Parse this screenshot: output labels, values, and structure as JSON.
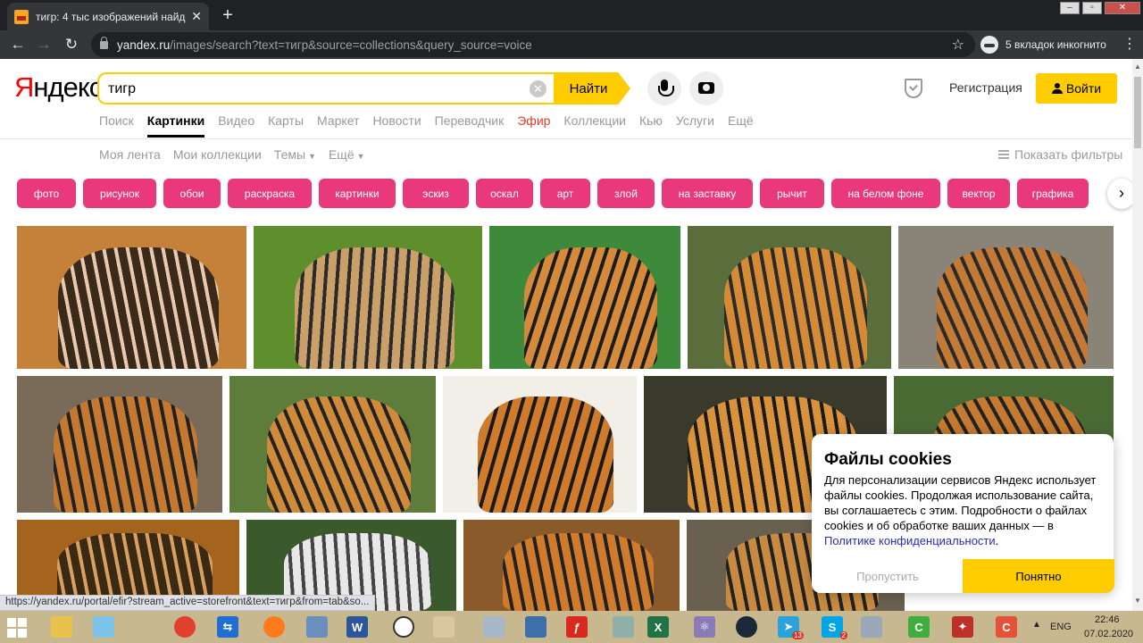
{
  "browser": {
    "tab_title": "тигр: 4 тыс изображений найде",
    "tab_close": "✕",
    "new_tab": "+",
    "url_host": "yandex.ru",
    "url_path": "/images/search?text=тигр&source=collections&query_source=voice",
    "incognito_label": "5 вкладок инкогнито",
    "back": "←",
    "forward": "→",
    "reload": "↻",
    "star": "☆",
    "menu": "⋮"
  },
  "header": {
    "logo_first": "Я",
    "logo_rest": "ндекс",
    "search_value": "тигр",
    "clear": "✕",
    "find_label": "Найти",
    "register_label": "Регистрация",
    "login_label": "Войти"
  },
  "services": [
    {
      "label": "Поиск",
      "state": "normal"
    },
    {
      "label": "Картинки",
      "state": "active"
    },
    {
      "label": "Видео",
      "state": "normal"
    },
    {
      "label": "Карты",
      "state": "normal"
    },
    {
      "label": "Маркет",
      "state": "normal"
    },
    {
      "label": "Новости",
      "state": "normal"
    },
    {
      "label": "Переводчик",
      "state": "normal"
    },
    {
      "label": "Эфир",
      "state": "efir"
    },
    {
      "label": "Коллекции",
      "state": "normal"
    },
    {
      "label": "Кью",
      "state": "normal"
    },
    {
      "label": "Услуги",
      "state": "normal"
    },
    {
      "label": "Ещё",
      "state": "normal"
    }
  ],
  "subnav": {
    "feed": "Моя лента",
    "collections": "Мои коллекции",
    "themes": "Темы",
    "more": "Ещё",
    "caret": "▼",
    "filters": "Показать фильтры"
  },
  "chips": [
    "фото",
    "рисунок",
    "обои",
    "раскраска",
    "картинки",
    "эскиз",
    "оскал",
    "арт",
    "злой",
    "на заставку",
    "рычит",
    "на белом фоне",
    "вектор",
    "графика"
  ],
  "chips_next": "›",
  "cookie": {
    "title": "Файлы cookies",
    "text": "Для персонализации сервисов Яндекс использует файлы cookies. Продолжая использование сайта, вы соглашаетесь с этим. Подробности о файлах cookies и об обработке ваших данных — в",
    "link": "Политике конфиденциальности",
    "skip": "Пропустить",
    "ok": "Понятно"
  },
  "status_url": "https://yandex.ru/portal/efir?stream_active=storefront&text=тигр&from=tab&so...",
  "scroll": {
    "up": "▲",
    "down": "▼"
  },
  "taskbar": {
    "apps": [
      {
        "name": "file-explorer",
        "color": "#e8c24a",
        "glyph": ""
      },
      {
        "name": "notes",
        "color": "#7ec3e8",
        "glyph": ""
      },
      {
        "name": "chrome",
        "color": "#e0412f",
        "glyph": ""
      },
      {
        "name": "teamviewer",
        "color": "#1f6fd0",
        "glyph": "⇆"
      },
      {
        "name": "firefox",
        "color": "#ff7a1a",
        "glyph": ""
      },
      {
        "name": "photos",
        "color": "#6a8fbf",
        "glyph": ""
      },
      {
        "name": "word",
        "color": "#2b579a",
        "glyph": "W"
      },
      {
        "name": "circle",
        "color": "#ffffff",
        "glyph": ""
      },
      {
        "name": "paint",
        "color": "#d9c7a0",
        "glyph": ""
      },
      {
        "name": "monitor",
        "color": "#a6b7c7",
        "glyph": ""
      },
      {
        "name": "virtualbox",
        "color": "#3f6fa8",
        "glyph": ""
      },
      {
        "name": "flash",
        "color": "#d9291c",
        "glyph": "ƒ"
      },
      {
        "name": "files",
        "color": "#8fb0a8",
        "glyph": ""
      },
      {
        "name": "excel",
        "color": "#217346",
        "glyph": "X"
      },
      {
        "name": "atom",
        "color": "#8a7ab5",
        "glyph": "⚛"
      },
      {
        "name": "steam",
        "color": "#1b2838",
        "glyph": ""
      },
      {
        "name": "telegram",
        "color": "#2aa3dd",
        "glyph": "➤"
      },
      {
        "name": "skype",
        "color": "#00a5e5",
        "glyph": "S"
      },
      {
        "name": "calculator",
        "color": "#9aa8b8",
        "glyph": ""
      },
      {
        "name": "camtasia",
        "color": "#3fae3f",
        "glyph": "C"
      },
      {
        "name": "filezilla",
        "color": "#c0302a",
        "glyph": "✦"
      },
      {
        "name": "app-c",
        "color": "#e5523a",
        "glyph": "C"
      }
    ],
    "badges": {
      "telegram": "13",
      "skype": "2"
    },
    "tray_arrow": "▲",
    "lang": "ENG",
    "time": "22:46",
    "date": "07.02.2020"
  }
}
